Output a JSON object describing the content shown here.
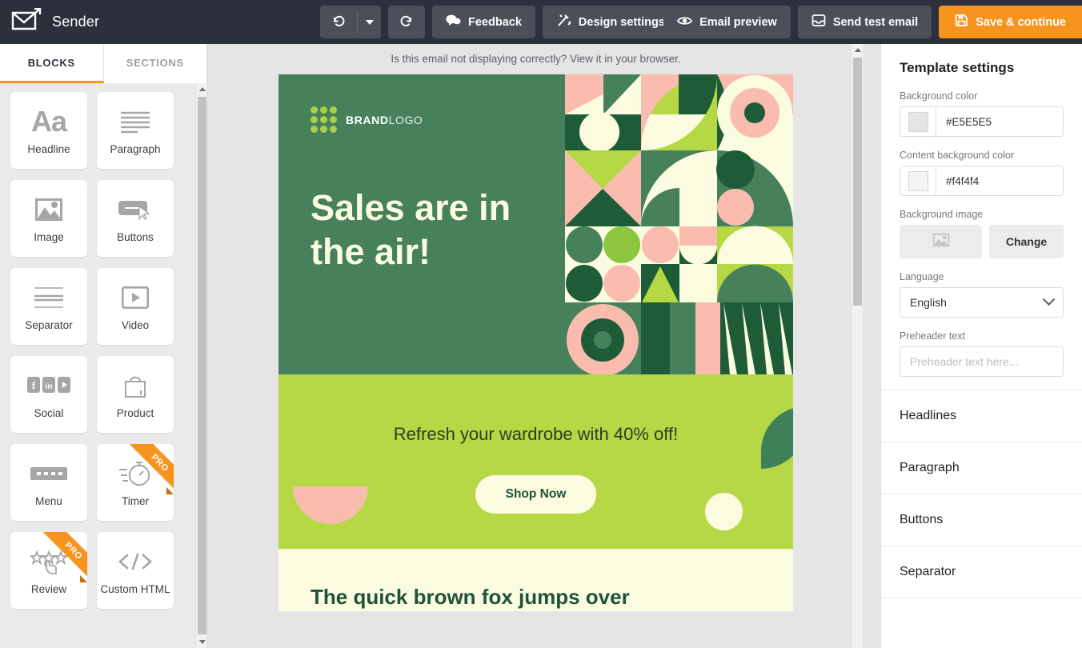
{
  "app": {
    "name": "Sender",
    "logo_icon": "envelope-arrow-icon"
  },
  "toolbar": {
    "undo": {
      "icon": "undo-icon",
      "label": ""
    },
    "undo_caret": {
      "icon": "chevron-down-icon"
    },
    "redo": {
      "icon": "redo-icon",
      "label": ""
    },
    "feedback": {
      "icon": "comment-icon",
      "label": "Feedback"
    },
    "design_settings": {
      "icon": "magic-wand-icon",
      "label": "Design settings"
    },
    "design_caret": {
      "icon": "chevron-down-icon"
    },
    "email_preview": {
      "icon": "eye-icon",
      "label": "Email preview"
    },
    "send_test": {
      "icon": "inbox-icon",
      "label": "Send test email"
    },
    "save_continue": {
      "icon": "save-icon",
      "label": "Save & continue",
      "color": "#f7941e"
    }
  },
  "left_panel": {
    "tabs": [
      {
        "label": "BLOCKS",
        "active": true
      },
      {
        "label": "SECTIONS",
        "active": false
      }
    ],
    "blocks": [
      {
        "label": "Headline",
        "icon": "aa-text-icon",
        "pro": false
      },
      {
        "label": "Paragraph",
        "icon": "lines-icon",
        "pro": false
      },
      {
        "label": "Image",
        "icon": "picture-icon",
        "pro": false
      },
      {
        "label": "Buttons",
        "icon": "button-cursor-icon",
        "pro": false
      },
      {
        "label": "Separator",
        "icon": "separator-icon",
        "pro": false
      },
      {
        "label": "Video",
        "icon": "play-icon",
        "pro": false
      },
      {
        "label": "Social",
        "icon": "social-icons",
        "pro": false
      },
      {
        "label": "Product",
        "icon": "shopping-bag-icon",
        "pro": false
      },
      {
        "label": "Menu",
        "icon": "menu-bar-icon",
        "pro": false
      },
      {
        "label": "Timer",
        "icon": "stopwatch-icon",
        "pro": true,
        "pro_label": "PRO"
      },
      {
        "label": "Review",
        "icon": "stars-hand-icon",
        "pro": true,
        "pro_label": "PRO"
      },
      {
        "label": "Custom HTML",
        "icon": "code-icon",
        "pro": false
      }
    ]
  },
  "canvas": {
    "preheader_note": "Is this email not displaying correctly? View it in your browser.",
    "email": {
      "hero": {
        "logo_brand": "BRAND",
        "logo_suffix": "LOGO",
        "headline_line1": "Sales are in",
        "headline_line2": "the air!",
        "bg_color": "#46815c",
        "headline_color": "#fbfbe0"
      },
      "promo": {
        "text": "Refresh your wardrobe with 40% off!",
        "button_label": "Shop Now",
        "bg_color": "#b5d844"
      },
      "bottom": {
        "heading": "The quick brown fox jumps over",
        "bg_color": "#fbfbe0"
      }
    }
  },
  "right_panel": {
    "title": "Template settings",
    "background_color": {
      "label": "Background color",
      "value": "#E5E5E5",
      "swatch": "#E5E5E5"
    },
    "content_background_color": {
      "label": "Content background color",
      "value": "#f4f4f4",
      "swatch": "#f4f4f4"
    },
    "background_image": {
      "label": "Background image",
      "change_label": "Change",
      "icon": "picture-icon"
    },
    "language": {
      "label": "Language",
      "value": "English"
    },
    "preheader": {
      "label": "Preheader text",
      "value": "",
      "placeholder": "Preheader text here..."
    },
    "accordion": [
      {
        "label": "Headlines"
      },
      {
        "label": "Paragraph"
      },
      {
        "label": "Buttons"
      },
      {
        "label": "Separator"
      }
    ]
  }
}
